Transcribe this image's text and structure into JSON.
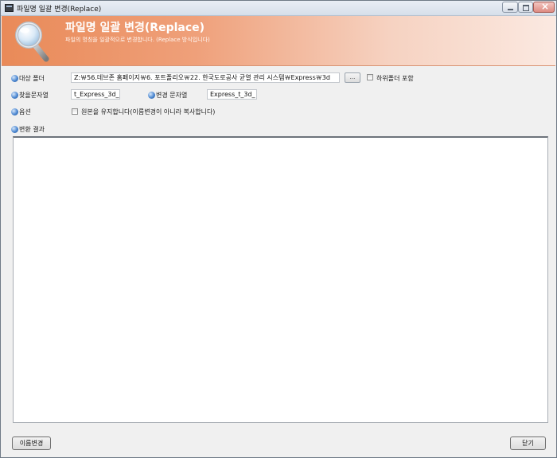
{
  "window": {
    "title": "파일명 일괄 변경(Replace)"
  },
  "banner": {
    "title": "파일명 일괄 변경(Replace)",
    "subtitle": "파일의 명칭을 일괄적으로 변경합니다. (Replace 방식입니다)",
    "gradient_start": "#e98a58",
    "gradient_end": "#fbe9e1",
    "icon": "magnifier-icon"
  },
  "form": {
    "target_folder_label": "대상 폴더",
    "target_folder_value": "Z:￦56.데브존 홈페이지￦6. 포트폴리오￦22. 한국도로공사 균열 관리 시스템￦Express￦3d",
    "browse_label": "...",
    "include_subfolders_label": "하위폴더 포함",
    "include_subfolders_checked": false,
    "find_label": "찾을문자열",
    "find_value": "t_Express_3d_",
    "replace_label": "변경 문자열",
    "replace_value": "Express_t_3d_",
    "options_label": "옵션",
    "keep_original_label": "원본을 유지합니다(이름변경이 아니라 복사합니다)",
    "keep_original_checked": false,
    "results_label": "변환 결과"
  },
  "buttons": {
    "rename": "이름변경",
    "close": "닫기"
  },
  "colors": {
    "bullet": "#4d88d1",
    "window_background": "#f0f0f0"
  }
}
